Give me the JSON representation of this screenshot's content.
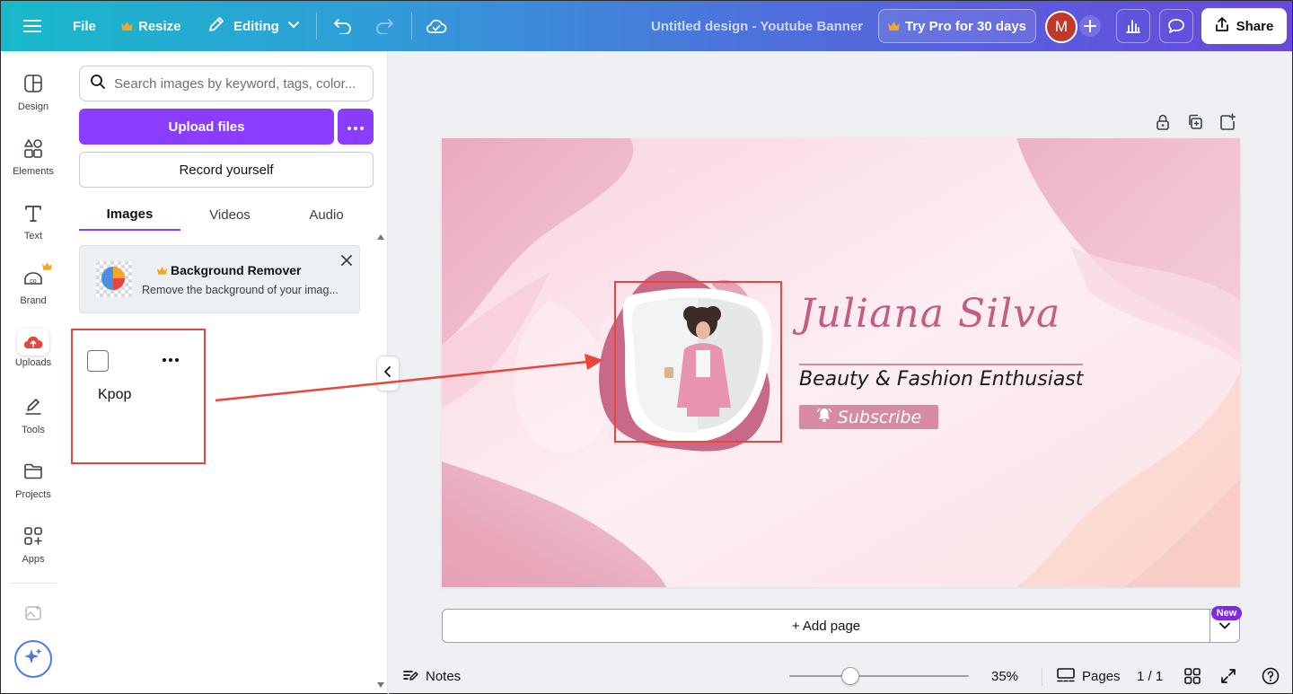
{
  "menu": {
    "file": "File",
    "resize": "Resize",
    "editing": "Editing"
  },
  "header": {
    "title": "Untitled design - Youtube Banner",
    "try_pro": "Try Pro for 30 days",
    "avatar_initial": "M",
    "share": "Share"
  },
  "sidebar": {
    "items": [
      {
        "label": "Design",
        "icon": "layout-icon"
      },
      {
        "label": "Elements",
        "icon": "shapes-icon"
      },
      {
        "label": "Text",
        "icon": "text-icon"
      },
      {
        "label": "Brand",
        "icon": "brand-icon"
      },
      {
        "label": "Uploads",
        "icon": "cloud-upload-icon"
      },
      {
        "label": "Tools",
        "icon": "pen-tool-icon"
      },
      {
        "label": "Projects",
        "icon": "folder-icon"
      },
      {
        "label": "Apps",
        "icon": "apps-grid-icon"
      }
    ]
  },
  "panel": {
    "search_placeholder": "Search images by keyword, tags, color...",
    "upload_label": "Upload files",
    "record_label": "Record yourself",
    "tabs": [
      "Images",
      "Videos",
      "Audio"
    ],
    "active_tab": "Images",
    "bg_remover": {
      "title": "Background Remover",
      "description": "Remove the background of your imag..."
    },
    "folder": {
      "name": "Kpop"
    }
  },
  "design": {
    "name": "Juliana Silva",
    "tagline": "Beauty & Fashion Enthusiast",
    "subscribe": "Subscribe"
  },
  "canvas": {
    "add_page": "+ Add page",
    "new_badge": "New"
  },
  "footer": {
    "notes": "Notes",
    "zoom": "35%",
    "zoom_level": 0.35,
    "pages_label": "Pages",
    "page_count": "1 / 1"
  },
  "colors": {
    "accent": "#8b3dff",
    "highlight": "#e8463a",
    "brand_pink": "#c25e80",
    "pro_crown": "#f5a623"
  }
}
